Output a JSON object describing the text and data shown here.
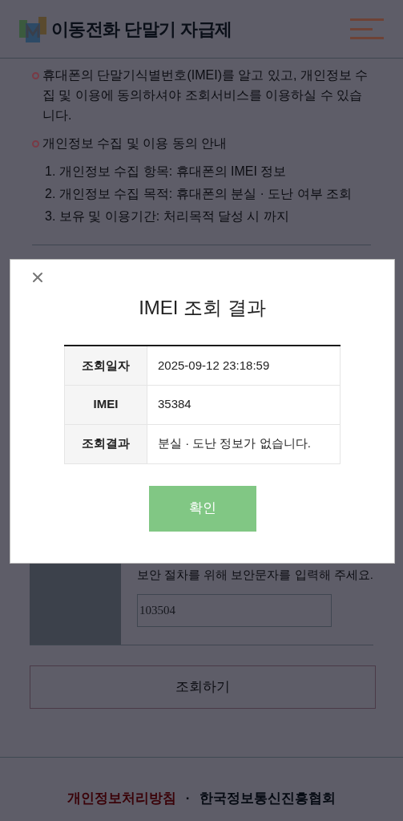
{
  "header": {
    "title": "이동전화 단말기 자급제"
  },
  "notices": [
    {
      "text": "휴대폰의 단말기식별번호(IMEI)를 알고 있고, 개인정보 수집 및 이용에 동의하셔야 조회서비스를 이용하실 수 있습니다."
    },
    {
      "text": "개인정보 수집 및 이용 동의 안내"
    }
  ],
  "privacy_items": [
    "1. 개인정보 수집 항목: 휴대폰의 IMEI 정보",
    "2. 개인정보 수집 목적: 휴대폰의 분실 · 도난 여부 조회",
    "3. 보유 및 이용기간: 처리목적 달성 시 까지"
  ],
  "captcha": {
    "instruction": "보안 절차를 위해 보안문자를 입력해 주세요.",
    "value": "103504"
  },
  "submit_button": "조회하기",
  "footer": {
    "links": [
      {
        "label": "개인정보처리방침",
        "kind": "highlight"
      },
      {
        "label": "한국정보통신진흥협회",
        "kind": "plain"
      }
    ],
    "separator": "·"
  },
  "modal": {
    "title": "IMEI 조회 결과",
    "rows": [
      {
        "label": "조회일자",
        "value": "2025-09-12 23:18:59"
      },
      {
        "label": "IMEI",
        "value": "35384"
      },
      {
        "label": "조회결과",
        "value": "분실 · 도난 정보가 없습니다."
      }
    ],
    "confirm_button": "확인"
  }
}
